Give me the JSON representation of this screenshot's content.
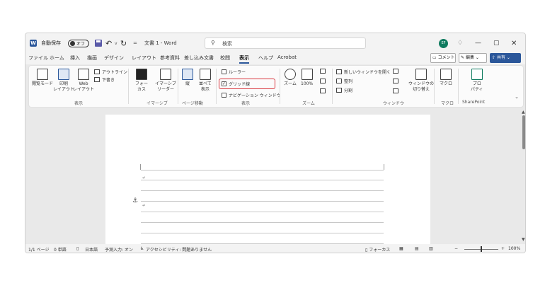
{
  "titlebar": {
    "autosave_label": "自動保存",
    "autosave_state": "オフ",
    "doc_title": "文書 1 - Word",
    "search_placeholder": "検索",
    "user_initials": "EF",
    "qat_more": "=",
    "undo_caret": "v"
  },
  "tabs": [
    "ファイル",
    "ホーム",
    "挿入",
    "描画",
    "デザイン",
    "レイアウト",
    "参考資料",
    "差し込み文書",
    "校閲",
    "表示",
    "ヘルプ",
    "Acrobat"
  ],
  "active_tab": "表示",
  "actions": {
    "comment": "コメント",
    "edit": "編集",
    "share": "共有"
  },
  "ribbon": {
    "views": {
      "read_mode": "閲覧モード",
      "print_layout": "印刷\nレイアウト",
      "web_layout": "Web\nレイアウト",
      "outline": "アウトライン",
      "draft": "下書き",
      "group": "表示"
    },
    "immersive": {
      "focus": "フォー\nカス",
      "reader": "イマーシブ\nリーダー",
      "group": "イマーシブ"
    },
    "page_move": {
      "vertical": "縦",
      "side": "並べて\n表示",
      "group": "ページ移動"
    },
    "show": {
      "ruler": "ルーラー",
      "gridlines": "グリッド線",
      "nav_pane": "ナビゲーション ウィンドウ",
      "group": "表示",
      "ruler_checked": false,
      "gridlines_checked": true,
      "nav_checked": false
    },
    "zoom": {
      "zoom": "ズーム",
      "pct": "100%",
      "group": "ズーム"
    },
    "window": {
      "new_window": "新しいウィンドウを開く",
      "arrange": "整列",
      "split": "分割",
      "switch": "ウィンドウの\n切り替え",
      "group": "ウィンドウ"
    },
    "macro": {
      "label": "マクロ",
      "group": "マクロ"
    },
    "sharepoint": {
      "label": "プロ\nパティ",
      "group": "SharePoint"
    }
  },
  "document": {
    "para_mark": "↵"
  },
  "statusbar": {
    "page": "1/1 ページ",
    "words": "0 単語",
    "lang": "日本語",
    "predict": "予測入力: オン",
    "accessibility": "アクセシビリティ: 問題ありません",
    "focus": "フォーカス",
    "zoom_minus": "−",
    "zoom_plus": "+",
    "zoom": "100%"
  }
}
